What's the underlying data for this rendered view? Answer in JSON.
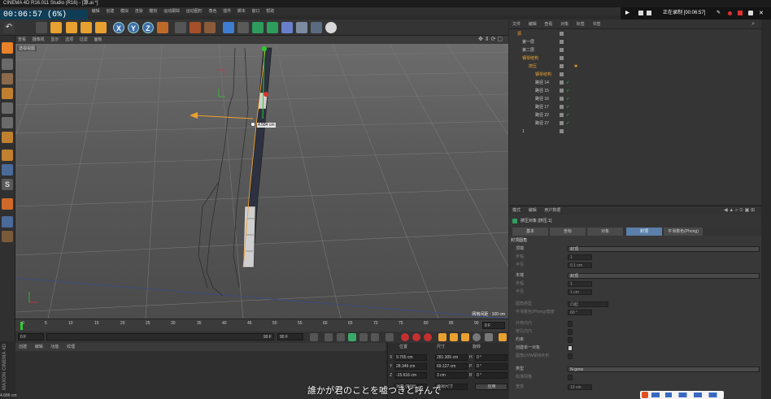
{
  "titlebar": {
    "title": "CINEMA 4D R16.011 Studio (R16) - [源.ai *]"
  },
  "menubar": {
    "items": [
      "文件",
      "编辑",
      "创建",
      "模拟",
      "渲染",
      "雕刻",
      "运动跟踪",
      "运动图形",
      "角色",
      "插件",
      "脚本",
      "窗口",
      "帮助"
    ]
  },
  "recording": {
    "elapsed": "00:06:57 (6%)",
    "status_label": "正在录制 [00:06:57]"
  },
  "viewport": {
    "menu": [
      "查看",
      "摄像机",
      "显示",
      "选项",
      "过滤",
      "面板"
    ],
    "label": "透视视图",
    "grid_spacing": "网格间距 : 100 cm",
    "measure_label": "4.584 cm"
  },
  "timeline": {
    "ticks": [
      "0",
      "5",
      "10",
      "15",
      "20",
      "25",
      "30",
      "35",
      "40",
      "45",
      "50",
      "55",
      "60",
      "65",
      "70",
      "75",
      "80",
      "85",
      "90"
    ],
    "end_frame": "0 F",
    "start_field": "0 F",
    "preview_end": "90 F",
    "end_field": "90 F"
  },
  "material": {
    "menu": [
      "创建",
      "编辑",
      "功能",
      "纹理"
    ]
  },
  "maxon": {
    "logo_text": "MAXON CINEMA 4D"
  },
  "coordinates": {
    "headers": [
      "位置",
      "尺寸",
      "旋转"
    ],
    "rows": [
      {
        "axis": "X",
        "pos": "9.765 cm",
        "size": "281.305 cm",
        "rot_axis": "H",
        "rot": "0 °"
      },
      {
        "axis": "Y",
        "pos": "28.349 cm",
        "size": "69.127 cm",
        "rot_axis": "P",
        "rot": "0 °"
      },
      {
        "axis": "Z",
        "pos": "-15.616 cm",
        "size": "3 cm",
        "rot_axis": "B",
        "rot": "0 °"
      }
    ],
    "mode": "对象 (相对)",
    "size_mode": "绝对尺寸",
    "apply": "应用"
  },
  "objects": {
    "menu": [
      "文件",
      "编辑",
      "查看",
      "对象",
      "标签",
      "书签"
    ],
    "rows": [
      {
        "name": "源",
        "indent": 0,
        "selected": true
      },
      {
        "name": "第一层",
        "indent": 1,
        "selected": false
      },
      {
        "name": "第二层",
        "indent": 1,
        "selected": false
      },
      {
        "name": "钢琴结构",
        "indent": 1,
        "selected": true
      },
      {
        "name": "挤压",
        "indent": 2,
        "selected": true
      },
      {
        "name": "钢琴结构",
        "indent": 3,
        "selected": true
      },
      {
        "name": "路径 14",
        "indent": 3,
        "selected": false
      },
      {
        "name": "路径 15",
        "indent": 3,
        "selected": false
      },
      {
        "name": "路径 16",
        "indent": 3,
        "selected": false
      },
      {
        "name": "路径 17",
        "indent": 3,
        "selected": false
      },
      {
        "name": "路径 22",
        "indent": 3,
        "selected": false
      },
      {
        "name": "路径 27",
        "indent": 3,
        "selected": false
      },
      {
        "name": "1",
        "indent": 1,
        "selected": false
      }
    ]
  },
  "attributes": {
    "menu": [
      "模式",
      "编辑",
      "用户数据"
    ],
    "title": "挤压对象 [挤压.1]",
    "tabs": [
      "基本",
      "坐标",
      "对象",
      "封顶",
      "平滑着色(Phong)"
    ],
    "active_tab": "封顶",
    "section": "封顶圆角",
    "rows": [
      {
        "label": "顶端",
        "value": "封顶",
        "dim": false
      },
      {
        "label": "步幅",
        "value": "1",
        "dim": true
      },
      {
        "label": "半径",
        "value": "0.1 cm",
        "dim": true
      },
      {
        "label": "末端",
        "value": "封顶",
        "dim": false
      },
      {
        "label": "步幅",
        "value": "1",
        "dim": true
      },
      {
        "label": "半径",
        "value": "1 cm",
        "dim": true
      },
      {
        "label": "圆角类型",
        "value": "凸起",
        "dim": true
      },
      {
        "label": "平滑着色(Phong)角度",
        "value": "60 °",
        "dim": true
      },
      {
        "label": "外壳向内",
        "value": "",
        "dim": true
      },
      {
        "label": "穿孔向内",
        "value": "",
        "dim": true
      },
      {
        "label": "约束",
        "value": "",
        "dim": false
      },
      {
        "label": "创建单一对象",
        "value": "",
        "dim": false
      },
      {
        "label": "圆角UVW保持外形",
        "value": "",
        "dim": true
      },
      {
        "label": "类型",
        "value": "N-gons",
        "dim": false
      },
      {
        "label": "标准网格",
        "value": "",
        "dim": true
      },
      {
        "label": "宽度",
        "value": "10 cm",
        "dim": true
      }
    ]
  },
  "subtitle": {
    "text": "誰かが君のことを嘘つきと呼んで"
  },
  "status": {
    "text": "4.686 cm"
  },
  "colors": {
    "accent_blue": "#3d6ea8",
    "selection_orange": "#f0a830",
    "axis_green": "#2fcc2f",
    "axis_red": "#d93030",
    "guide_orange": "#f0a030"
  }
}
